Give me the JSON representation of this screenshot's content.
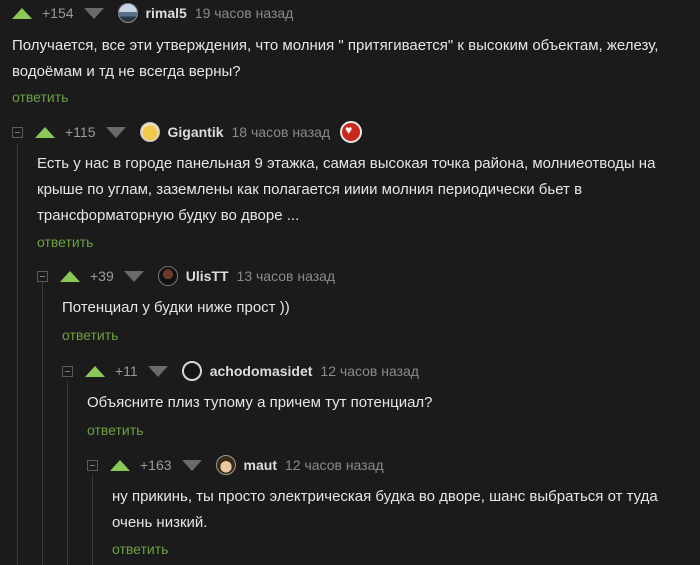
{
  "reply_label": "ответить",
  "colors": {
    "accent": "#8ac858",
    "link": "#6da13f",
    "background": "#1b1b1c"
  },
  "comments": [
    {
      "rating": "+154",
      "user": "rimal5",
      "time": "19 часов назад",
      "avatar_icon": "landscape-avatar",
      "text": [
        "Получается, все эти утверждения, что молния \" притягивается\" к высоким объектам, железу,",
        "водоёмам и тд не всегда верны?"
      ]
    },
    {
      "rating": "+115",
      "user": "Gigantik",
      "time": "18 часов назад",
      "avatar_icon": "emoji-avatar",
      "badge_icon": "award-heart-icon",
      "text": [
        "Есть у нас в городе панельная 9 этажка, самая высокая точка района, молниеотводы на",
        "крыше по углам, заземлены как полагается ииии молния периодически бьет в",
        "трансформаторную будку во дворе ..."
      ]
    },
    {
      "rating": "+39",
      "user": "UlisTT",
      "time": "13 часов назад",
      "avatar_icon": "dark-avatar",
      "text": [
        "Потенциал у будки ниже прост ))"
      ]
    },
    {
      "rating": "+11",
      "user": "achodomasidet",
      "time": "12 часов назад",
      "avatar_icon": "ring-avatar",
      "text": [
        "Объясните плиз тупому а причем тут потенциал?"
      ]
    },
    {
      "rating": "+163",
      "user": "maut",
      "time": "12 часов назад",
      "avatar_icon": "cartoon-avatar",
      "text": [
        "ну прикинь, ты просто электрическая будка во дворе, шанс выбраться от туда",
        "очень низкий."
      ]
    }
  ]
}
